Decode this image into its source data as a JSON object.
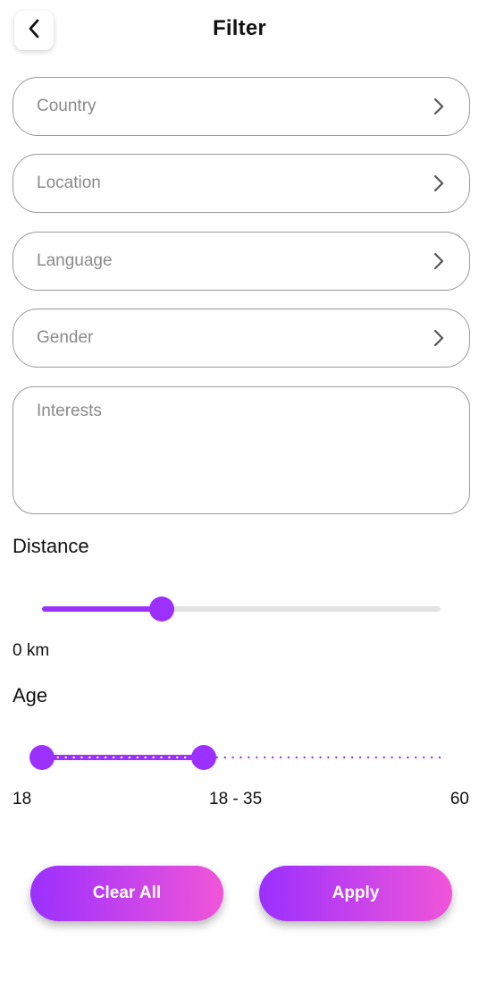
{
  "header": {
    "title": "Filter",
    "back_icon": "chevron-left-icon"
  },
  "fields": {
    "country": {
      "placeholder": "Country",
      "icon": "chevron-right-icon"
    },
    "location": {
      "placeholder": "Location",
      "icon": "chevron-right-icon"
    },
    "language": {
      "placeholder": "Language",
      "icon": "chevron-right-icon"
    },
    "gender": {
      "placeholder": "Gender",
      "icon": "chevron-right-icon"
    },
    "interests": {
      "placeholder": "Interests"
    }
  },
  "distance": {
    "label": "Distance",
    "value_text": "0 km",
    "fill_fraction": 0.3
  },
  "age": {
    "label": "Age",
    "min_label": "18",
    "range_text": "18 - 35",
    "max_label": "60",
    "min": 18,
    "max": 60,
    "low": 18,
    "high": 35
  },
  "buttons": {
    "clear": "Clear All",
    "apply": "Apply"
  },
  "colors": {
    "accent": "#9b30ff",
    "gradient_end": "#f055d8",
    "track_inactive": "#e2e2e2",
    "border": "#9a9a9a",
    "placeholder": "#8a8a8a"
  }
}
